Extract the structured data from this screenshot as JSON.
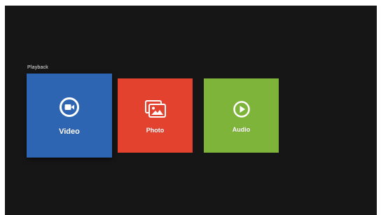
{
  "playback": {
    "section_label": "Playback",
    "tiles": [
      {
        "label": "Video",
        "icon": "video-camera-icon",
        "color": "#2e65b2",
        "state": "focused"
      },
      {
        "label": "Photo",
        "icon": "photo-gallery-icon",
        "color": "#e2422e"
      },
      {
        "label": "Audio",
        "icon": "play-circle-icon",
        "color": "#7fb43a"
      }
    ]
  }
}
